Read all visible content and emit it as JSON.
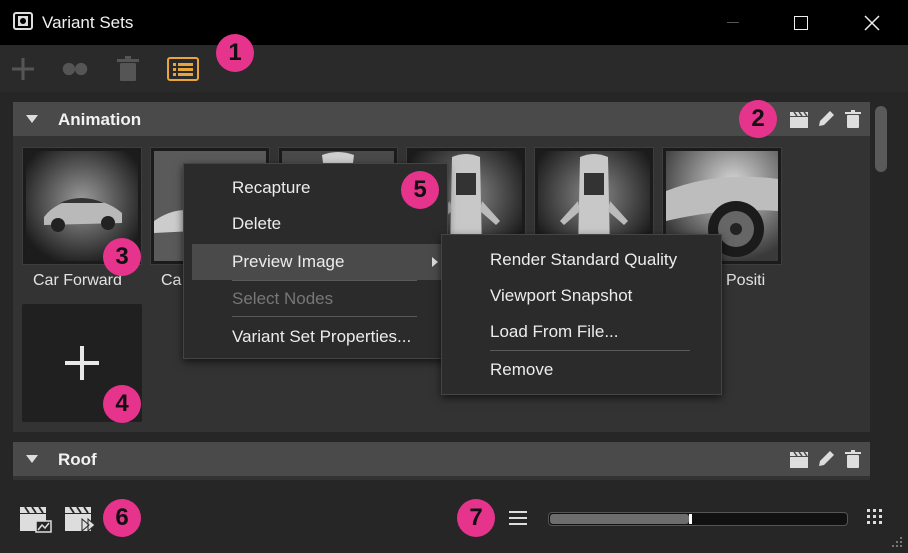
{
  "window": {
    "title": "Variant Sets",
    "controls": {
      "minimize": "minimize-icon",
      "maximize": "maximize-icon",
      "close": "close-icon"
    }
  },
  "toolbar": {
    "icons": [
      "add-icon",
      "group-icon",
      "delete-icon",
      "grid-view-icon"
    ]
  },
  "sections": [
    {
      "title": "Animation",
      "header_icons": [
        "render-clapper-icon",
        "edit-pencil-icon",
        "trash-icon"
      ],
      "thumbnails": [
        {
          "label": "Car Forward"
        },
        {
          "label": "Ca"
        },
        {
          "label": ""
        },
        {
          "label": ""
        },
        {
          "label": ""
        },
        {
          "label": "Positi"
        }
      ],
      "add_tile_icon": "plus-icon"
    },
    {
      "title": "Roof",
      "header_icons": [
        "render-clapper-icon",
        "edit-pencil-icon",
        "trash-icon"
      ]
    }
  ],
  "context_menu": {
    "items": [
      {
        "label": "Recapture",
        "enabled": true
      },
      {
        "label": "Delete",
        "enabled": true
      },
      {
        "label": "Preview Image",
        "enabled": true,
        "highlighted": true,
        "submenu": true
      },
      {
        "label": "Select Nodes",
        "enabled": false
      },
      {
        "label": "Variant Set Properties...",
        "enabled": true
      }
    ]
  },
  "submenu": {
    "items": [
      {
        "label": "Render Standard Quality"
      },
      {
        "label": "Viewport Snapshot"
      },
      {
        "label": "Load From File..."
      },
      {
        "label": "Remove"
      }
    ]
  },
  "bottom_bar": {
    "left_icons": [
      "render-image-icon",
      "render-sequence-icon"
    ],
    "list_view_icon": "list-view-icon",
    "grid_size_icon": "grid-size-icon",
    "thumbnail_size_fraction": 0.47
  },
  "callouts": [
    "1",
    "2",
    "3",
    "4",
    "5",
    "6",
    "7"
  ],
  "colors": {
    "callout": "#e6338c",
    "header": "#4a4a4a",
    "accent_icon": "#e8a53a"
  }
}
